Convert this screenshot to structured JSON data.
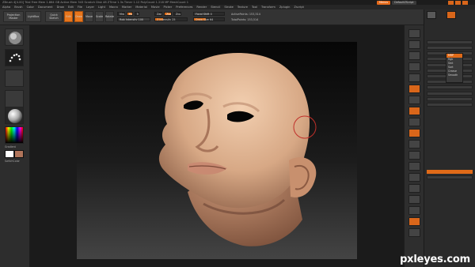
{
  "window": {
    "title": "ZBrush 4[4.00] Trial  Free Mem 1.864 GB  Active Mem 543  Scratch Disk 48  ZTime 1.3s  Timer 1.12  PolyCount 1.218 MP  MeshCount 1"
  },
  "menubar": {
    "items": [
      "Alpha",
      "Brush",
      "Color",
      "Document",
      "Draw",
      "Edit",
      "File",
      "Layer",
      "Light",
      "Macro",
      "Marker",
      "Material",
      "Movie",
      "Picker",
      "Preferences",
      "Render",
      "Stencil",
      "Stroke",
      "Texture",
      "Tool",
      "Transform",
      "Zplugin",
      "Zscript"
    ],
    "menus_label": "Menus",
    "script_label": "DefaultZScript"
  },
  "toolbar": {
    "projection_master": "Projection Master",
    "lightbox": "LightBox",
    "quick_sketch": "Quick Sketch",
    "edit": "Edit",
    "draw": "Draw",
    "move": "Move",
    "scale": "Scale",
    "rotate": "Rotate",
    "mrgb": "Mrgb",
    "rgb": "Rgb",
    "m": "M",
    "zadd": "Zadd",
    "zsub": "Zsub",
    "zcut": "Zcut",
    "rgb_intensity_label": "Rgb Intensity 100",
    "z_intensity_label": "Z Intensity 25",
    "focal_shift_label": "Focal Shift 0",
    "draw_size_label": "Draw Size 64",
    "active_points": "ActivePoints: 153,514",
    "total_points": "TotalPoints: 153,514"
  },
  "leftbar": {
    "texture_label": "Gradient",
    "switch_label": "SwitchColor",
    "alternate_label": "Alternate"
  },
  "rightpanel": {
    "items": [
      {
        "label": "SubTool",
        "style": "head"
      },
      {
        "label": "Layers",
        "style": "head"
      },
      {
        "label": "Geometry",
        "style": "sub"
      },
      {
        "label": "Lower Res",
        "style": "btn"
      },
      {
        "label": "Higher Res",
        "style": "btn"
      },
      {
        "label": "Del Lower",
        "style": "btn"
      },
      {
        "label": "Divide",
        "style": "btn"
      },
      {
        "label": "Edge Loop",
        "style": "btn"
      },
      {
        "label": "Crease",
        "style": "btn"
      },
      {
        "label": "ShadowBox",
        "style": "btn"
      },
      {
        "label": "ClayPolish",
        "style": "btn"
      },
      {
        "label": "DynaMesh",
        "style": "btn"
      },
      {
        "label": "Position",
        "style": "btn"
      },
      {
        "label": "Size",
        "style": "btn"
      },
      {
        "label": "MeshIntegrity",
        "style": "btn"
      },
      {
        "label": "Geometry HD",
        "style": "head"
      },
      {
        "label": "Preview",
        "style": "head"
      },
      {
        "label": "Surface",
        "style": "head"
      },
      {
        "label": "Deformation",
        "style": "head"
      },
      {
        "label": "Masking",
        "style": "head"
      },
      {
        "label": "Visibility",
        "style": "head"
      },
      {
        "label": "Polygroups",
        "style": "head"
      },
      {
        "label": "Contact",
        "style": "head"
      },
      {
        "label": "Morph Target",
        "style": "head"
      },
      {
        "label": "Polypaint",
        "style": "sub"
      },
      {
        "label": "Colorize",
        "style": "obtn"
      },
      {
        "label": "Polypaint From Polygroups",
        "style": "btn"
      },
      {
        "label": "UV Map",
        "style": "head"
      },
      {
        "label": "Texture Map",
        "style": "head"
      },
      {
        "label": "Displacement Map",
        "style": "head"
      },
      {
        "label": "Normal Map",
        "style": "head"
      },
      {
        "label": "Display Properties",
        "style": "head"
      },
      {
        "label": "Unified Skin",
        "style": "head"
      },
      {
        "label": "Import",
        "style": "head"
      },
      {
        "label": "Export",
        "style": "head"
      }
    ],
    "popup": [
      "MRP",
      "Rgb",
      "Smt",
      "Sort",
      "Crease",
      "Smooth"
    ]
  },
  "canvas": {
    "brush_cursor": "brush-circle"
  },
  "watermark": "pxleyes.com",
  "colors": {
    "accent": "#e8761c",
    "panel": "#2a2a2a",
    "skin": "#d9ad8a"
  }
}
